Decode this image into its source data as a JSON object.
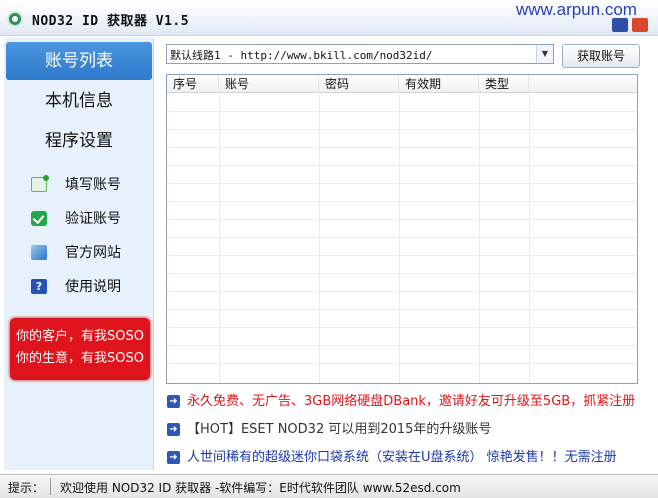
{
  "window": {
    "title": "NOD32 ID 获取器 V1.5",
    "watermark": "www.arpun.com"
  },
  "sidebar": {
    "nav": [
      {
        "label": "账号列表",
        "active": true
      },
      {
        "label": "本机信息",
        "active": false
      },
      {
        "label": "程序设置",
        "active": false
      }
    ],
    "tools": [
      {
        "label": "填写账号",
        "icon": "write-account-icon"
      },
      {
        "label": "验证账号",
        "icon": "verify-check-icon"
      },
      {
        "label": "官方网站",
        "icon": "website-icon"
      },
      {
        "label": "使用说明",
        "icon": "help-icon"
      }
    ],
    "ad": {
      "line1": "你的客户，有我SOSO",
      "line2": "你的生意，有我SOSO"
    }
  },
  "toolbar": {
    "route_value": "默认线路1 - http://www.bkill.com/nod32id/",
    "get_button": "获取账号"
  },
  "table": {
    "columns": [
      "序号",
      "账号",
      "密码",
      "有效期",
      "类型"
    ],
    "rows": []
  },
  "links": [
    {
      "text": "永久免费、无广告、3GB网络硬盘DBank，邀请好友可升级至5GB，抓紧注册"
    },
    {
      "text": "【HOT】ESET NOD32 可以用到2015年的升级账号"
    },
    {
      "text": "人世间稀有的超级迷你口袋系统（安装在U盘系统） 惊艳发售！！无需注册"
    }
  ],
  "status": {
    "label": "提示：",
    "message": "欢迎使用 NOD32 ID 获取器 -软件编写：E时代软件团队 www.52esd.com"
  },
  "colors": {
    "accent": "#2f79cc",
    "sidebar_bg": "#e7f1fb",
    "ad_red": "#e0141c",
    "link_red": "#e4141a",
    "link_blue": "#1c37a8"
  }
}
